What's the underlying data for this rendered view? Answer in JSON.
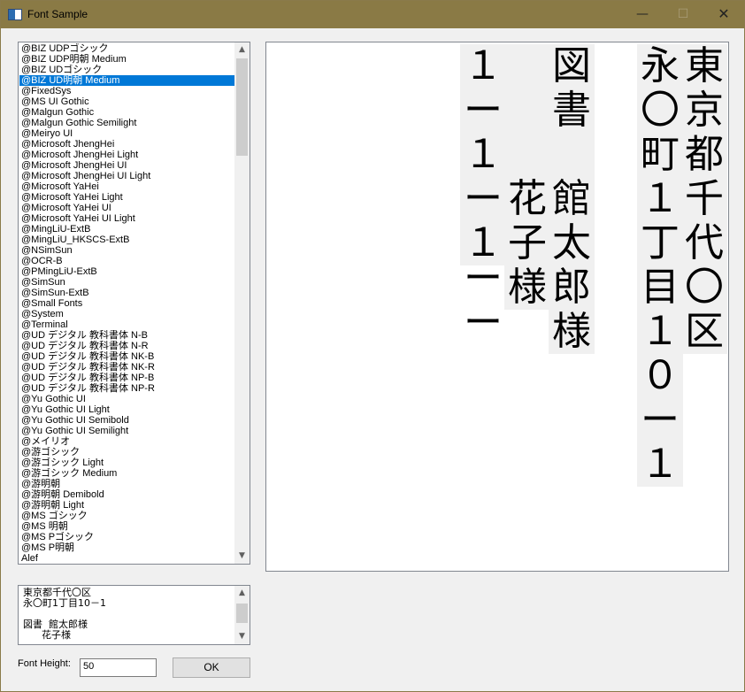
{
  "window": {
    "title": "Font Sample",
    "minimize": "—",
    "maximize": "☐",
    "close": "✕"
  },
  "font_list": {
    "selected_index": 3,
    "items": [
      "@BIZ UDPゴシック",
      "@BIZ UDP明朝 Medium",
      "@BIZ UDゴシック",
      "@BIZ UD明朝 Medium",
      "@FixedSys",
      "@MS UI Gothic",
      "@Malgun Gothic",
      "@Malgun Gothic Semilight",
      "@Meiryo UI",
      "@Microsoft JhengHei",
      "@Microsoft JhengHei Light",
      "@Microsoft JhengHei UI",
      "@Microsoft JhengHei UI Light",
      "@Microsoft YaHei",
      "@Microsoft YaHei Light",
      "@Microsoft YaHei UI",
      "@Microsoft YaHei UI Light",
      "@MingLiU-ExtB",
      "@MingLiU_HKSCS-ExtB",
      "@NSimSun",
      "@OCR-B",
      "@PMingLiU-ExtB",
      "@SimSun",
      "@SimSun-ExtB",
      "@Small Fonts",
      "@System",
      "@Terminal",
      "@UD デジタル 教科書体 N-B",
      "@UD デジタル 教科書体 N-R",
      "@UD デジタル 教科書体 NK-B",
      "@UD デジタル 教科書体 NK-R",
      "@UD デジタル 教科書体 NP-B",
      "@UD デジタル 教科書体 NP-R",
      "@Yu Gothic UI",
      "@Yu Gothic UI Light",
      "@Yu Gothic UI Semibold",
      "@Yu Gothic UI Semilight",
      "@メイリオ",
      "@游ゴシック",
      "@游ゴシック Light",
      "@游ゴシック Medium",
      "@游明朝",
      "@游明朝 Demibold",
      "@游明朝 Light",
      "@MS ゴシック",
      "@MS 明朝",
      "@MS Pゴシック",
      "@MS P明朝",
      "Alef"
    ]
  },
  "preview": {
    "columns": [
      "東京都千代〇区",
      "永〇町１丁目１０ー１",
      "",
      "図書　館太郎様",
      "　　　花子様",
      "",
      "１ー１ー１",
      "ーー"
    ]
  },
  "text_input": {
    "lines": [
      "東京都千代〇区",
      "永〇町1丁目10－1",
      "",
      "図書  館太郎様",
      "      花子様"
    ]
  },
  "font_height": {
    "label": "Font Height:",
    "value": "50"
  },
  "ok_button": "OK",
  "scroll_icons": {
    "up": "▲",
    "down": "▼"
  }
}
